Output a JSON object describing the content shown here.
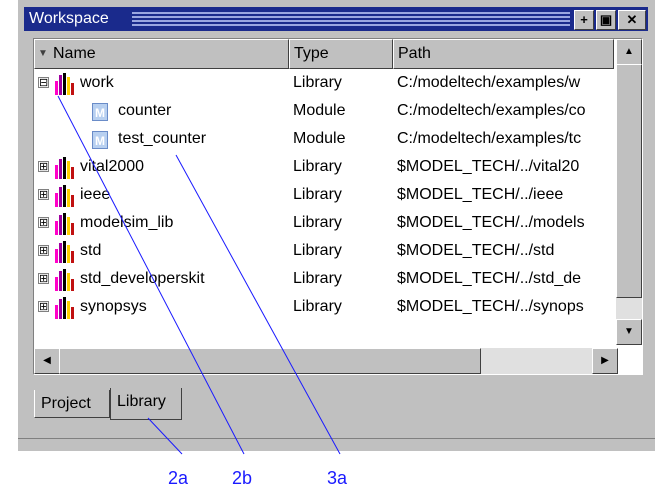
{
  "window": {
    "title": "Workspace"
  },
  "titlebar_buttons": [
    "+",
    "▣",
    "✕"
  ],
  "columns": [
    {
      "label": "Name"
    },
    {
      "label": "Type"
    },
    {
      "label": "Path"
    }
  ],
  "rows": [
    {
      "name": "work",
      "type": "Library",
      "path": "C:/modeltech/examples/w",
      "kind": "library",
      "expander": "⊟"
    },
    {
      "name": "counter",
      "type": "Module",
      "path": "C:/modeltech/examples/co",
      "kind": "module"
    },
    {
      "name": "test_counter",
      "type": "Module",
      "path": "C:/modeltech/examples/tc",
      "kind": "module"
    },
    {
      "name": "vital2000",
      "type": "Library",
      "path": "$MODEL_TECH/../vital20",
      "kind": "library",
      "expander": "⊞"
    },
    {
      "name": "ieee",
      "type": "Library",
      "path": "$MODEL_TECH/../ieee",
      "kind": "library",
      "expander": "⊞"
    },
    {
      "name": "modelsim_lib",
      "type": "Library",
      "path": "$MODEL_TECH/../models",
      "kind": "library",
      "expander": "⊞"
    },
    {
      "name": "std",
      "type": "Library",
      "path": "$MODEL_TECH/../std",
      "kind": "library",
      "expander": "⊞"
    },
    {
      "name": "std_developerskit",
      "type": "Library",
      "path": "$MODEL_TECH/../std_de",
      "kind": "library",
      "expander": "⊞"
    },
    {
      "name": "synopsys",
      "type": "Library",
      "path": "$MODEL_TECH/../synops",
      "kind": "library",
      "expander": "⊞"
    }
  ],
  "tabs": [
    {
      "label": "Project",
      "active": false
    },
    {
      "label": "Library",
      "active": true
    }
  ],
  "callouts": [
    {
      "label": "2a"
    },
    {
      "label": "2b"
    },
    {
      "label": "3a"
    }
  ],
  "colors": {
    "titlebar": "#1a2a8c",
    "chrome": "#c0c0c0",
    "callout": "#1a1aff",
    "module_icon": "#b8d0f0"
  }
}
